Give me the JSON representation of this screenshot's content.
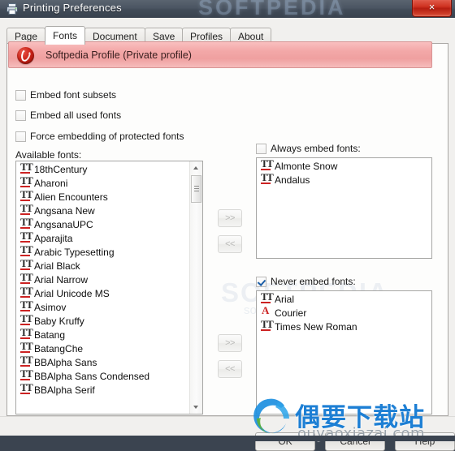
{
  "window": {
    "title": "Printing Preferences",
    "icon": "printer-icon",
    "close_label": "×",
    "watermark_title": "SOFTPEDIA"
  },
  "tabs": [
    {
      "label": "Page",
      "active": false
    },
    {
      "label": "Fonts",
      "active": true
    },
    {
      "label": "Document",
      "active": false
    },
    {
      "label": "Save",
      "active": false
    },
    {
      "label": "Profiles",
      "active": false
    },
    {
      "label": "About",
      "active": false
    }
  ],
  "profile": {
    "label": "Softpedia Profile (Private profile)",
    "icon": "profile-swirl-icon",
    "accent_color": "#f3a8a8",
    "border_color": "#d79494"
  },
  "options": [
    {
      "label": "Embed font subsets",
      "checked": false
    },
    {
      "label": "Embed all used fonts",
      "checked": false
    },
    {
      "label": "Force embedding of protected fonts",
      "checked": false
    }
  ],
  "available": {
    "label": "Available fonts:",
    "items": [
      {
        "name": "18thCentury",
        "type": "tt"
      },
      {
        "name": "Aharoni",
        "type": "tt"
      },
      {
        "name": "Alien Encounters",
        "type": "tt"
      },
      {
        "name": "Angsana New",
        "type": "tt"
      },
      {
        "name": "AngsanaUPC",
        "type": "tt"
      },
      {
        "name": "Aparajita",
        "type": "tt"
      },
      {
        "name": "Arabic Typesetting",
        "type": "tt"
      },
      {
        "name": "Arial Black",
        "type": "tt"
      },
      {
        "name": "Arial Narrow",
        "type": "tt"
      },
      {
        "name": "Arial Unicode MS",
        "type": "tt"
      },
      {
        "name": "Asimov",
        "type": "tt"
      },
      {
        "name": "Baby Kruffy",
        "type": "tt"
      },
      {
        "name": "Batang",
        "type": "tt"
      },
      {
        "name": "BatangChe",
        "type": "tt"
      },
      {
        "name": "BBAlpha Sans",
        "type": "tt"
      },
      {
        "name": "BBAlpha Sans Condensed",
        "type": "tt"
      },
      {
        "name": "BBAlpha Serif",
        "type": "tt"
      }
    ]
  },
  "always_embed": {
    "label": "Always embed fonts:",
    "checked": false,
    "items": [
      {
        "name": "Almonte Snow",
        "type": "tt"
      },
      {
        "name": "Andalus",
        "type": "tt"
      }
    ]
  },
  "never_embed": {
    "label": "Never embed fonts:",
    "checked": true,
    "items": [
      {
        "name": "Arial",
        "type": "tt"
      },
      {
        "name": "Courier",
        "type": "ps"
      },
      {
        "name": "Times New Roman",
        "type": "tt"
      }
    ]
  },
  "transfer": {
    "add_label": ">>",
    "remove_label": "<<"
  },
  "footer": {
    "ok_label": "OK",
    "cancel_label": "Cancel",
    "help_label": "Help"
  },
  "site_watermark": {
    "cn_text": "偶要下载站",
    "url_text": "ouyaoxiazai.com",
    "brand_color": "#1d7fd4",
    "mid_text": "SOFTPEDIA",
    "mid_sub": "softpedia.com"
  }
}
